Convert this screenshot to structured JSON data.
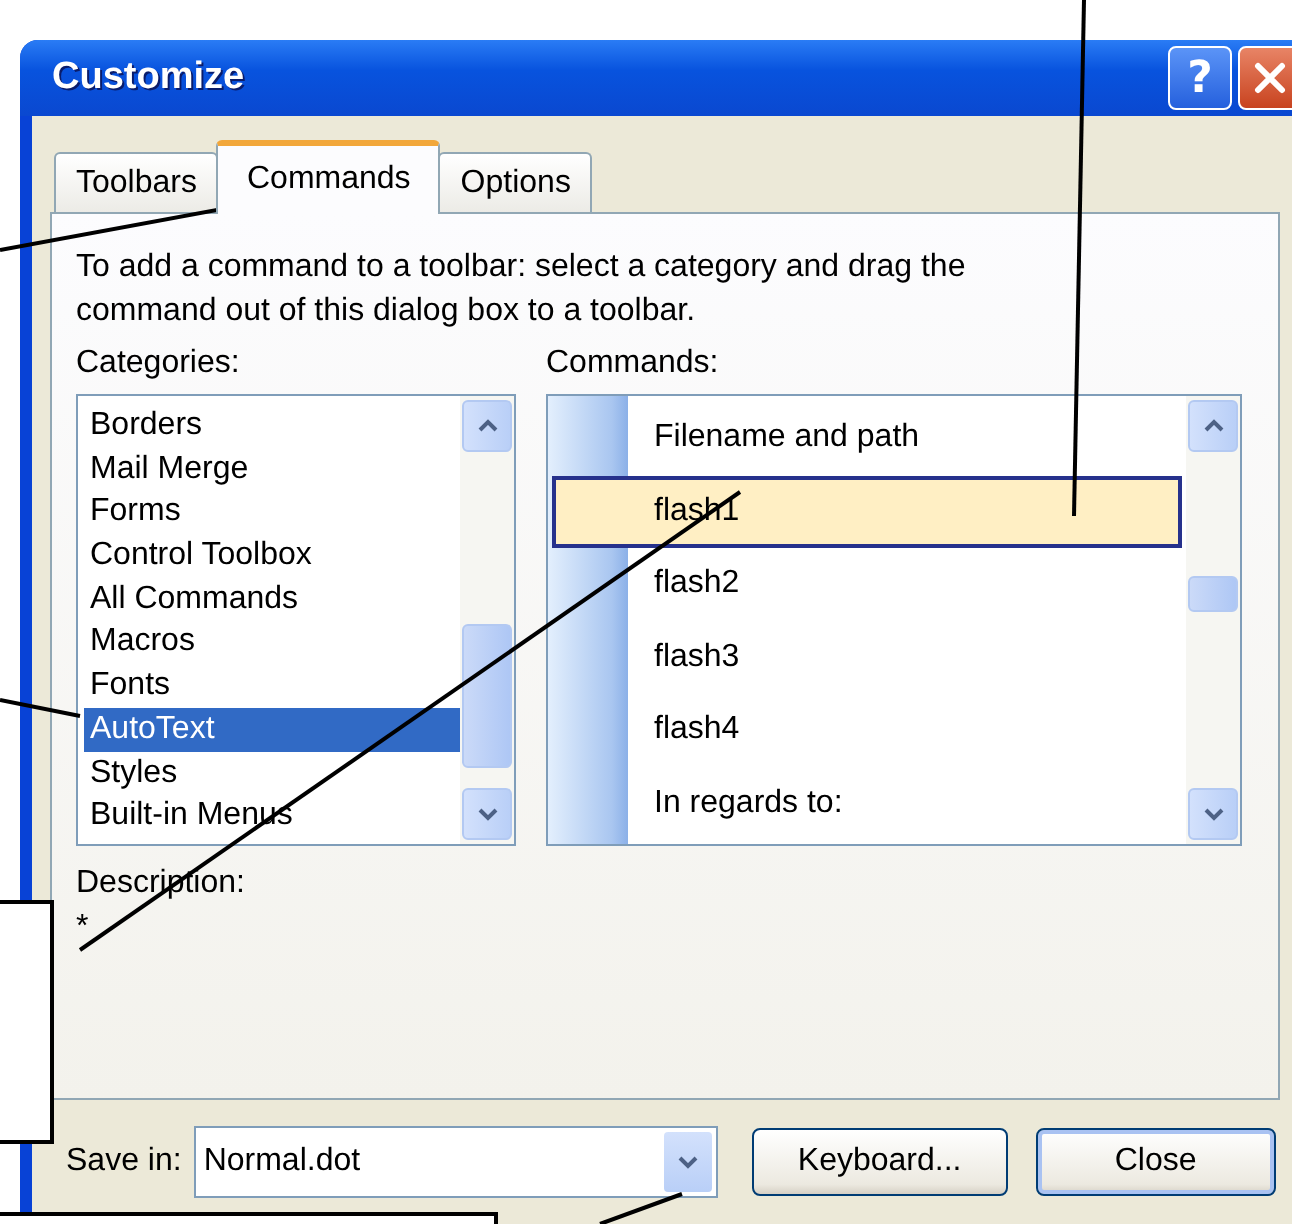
{
  "window": {
    "title": "Customize",
    "help_button": "?"
  },
  "tabs": [
    {
      "label": "Toolbars",
      "selected": false
    },
    {
      "label": "Commands",
      "selected": true
    },
    {
      "label": "Options",
      "selected": false
    }
  ],
  "instructions": "To add a command to a toolbar: select a category and drag the command out of this dialog box to a toolbar.",
  "categories": {
    "label": "Categories:",
    "items": [
      {
        "label": "Borders",
        "selected": false
      },
      {
        "label": "Mail Merge",
        "selected": false
      },
      {
        "label": "Forms",
        "selected": false
      },
      {
        "label": "Control Toolbox",
        "selected": false
      },
      {
        "label": "All Commands",
        "selected": false
      },
      {
        "label": "Macros",
        "selected": false
      },
      {
        "label": "Fonts",
        "selected": false
      },
      {
        "label": "AutoText",
        "selected": true
      },
      {
        "label": "Styles",
        "selected": false
      },
      {
        "label": "Built-in Menus",
        "selected": false
      }
    ]
  },
  "commands": {
    "label": "Commands:",
    "items": [
      {
        "label": "Filename and path",
        "selected": false
      },
      {
        "label": "flash1",
        "selected": true
      },
      {
        "label": "flash2",
        "selected": false
      },
      {
        "label": "flash3",
        "selected": false
      },
      {
        "label": "flash4",
        "selected": false
      },
      {
        "label": "In regards to:",
        "selected": false
      }
    ]
  },
  "description": {
    "label": "Description:",
    "value": "*"
  },
  "save_in": {
    "label": "Save in:",
    "value": "Normal.dot"
  },
  "buttons": [
    {
      "label": "Keyboard...",
      "default": false
    },
    {
      "label": "Close",
      "default": true
    }
  ]
}
